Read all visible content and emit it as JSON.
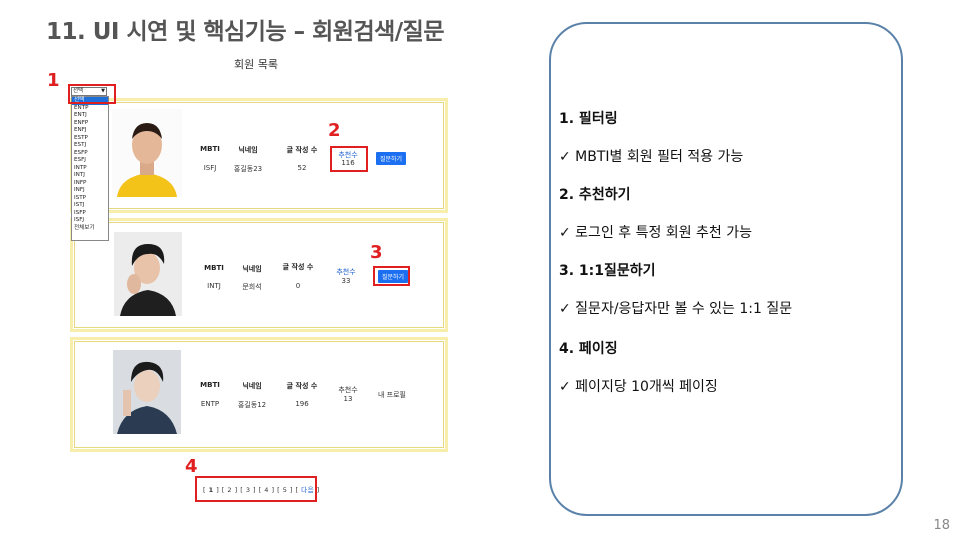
{
  "slide": {
    "title": "11. UI 시연 및 핵심기능 – 회원검색/질문",
    "page_number": "18"
  },
  "member_list": {
    "caption": "회원 목록",
    "columns": {
      "mbti": "MBTI",
      "nickname": "닉네임",
      "posts": "글 작성 수"
    },
    "recommend_label": "추천수",
    "ask_label": "질문하기",
    "my_profile_label": "내 프로필",
    "members": [
      {
        "mbti": "ISFJ",
        "nickname": "홍길동23",
        "posts": "52",
        "recommend": "116"
      },
      {
        "mbti": "INTJ",
        "nickname": "문희석",
        "posts": "0",
        "recommend": "33"
      },
      {
        "mbti": "ENTP",
        "nickname": "홍길동12",
        "posts": "196",
        "recommend": "13"
      }
    ]
  },
  "filter": {
    "selected": "선택",
    "options": [
      "선택",
      "ENTP",
      "ENTJ",
      "ENFP",
      "ENFJ",
      "ESTP",
      "ESTJ",
      "ESFP",
      "ESFJ",
      "INTP",
      "INTJ",
      "INFP",
      "INFJ",
      "ISTP",
      "ISTJ",
      "ISFP",
      "ISFJ",
      "전체보기"
    ]
  },
  "pagination": {
    "pages": [
      "1",
      "2",
      "3",
      "4",
      "5"
    ],
    "current": "1",
    "next_label": "다음"
  },
  "callouts": [
    "1",
    "2",
    "3",
    "4"
  ],
  "features": {
    "f1_title": "1.  필터링",
    "f1_desc": "✓ MBTI별 회원 필터 적용 가능",
    "f2_title": "2. 추천하기",
    "f2_desc": "✓ 로그인 후 특정 회원 추천 가능",
    "f3_title": "3. 1:1질문하기",
    "f3_desc": "✓ 질문자/응답자만 볼 수 있는 1:1 질문",
    "f4_title": "4. 페이징",
    "f4_desc": "✓ 페이지당 10개씩 페이징"
  },
  "colors": {
    "callout_red": "#e02020",
    "card_border": "#f6eeaa",
    "button_blue": "#1b6ff0",
    "link_blue": "#1a5fd0",
    "info_border": "#5a81a8"
  }
}
